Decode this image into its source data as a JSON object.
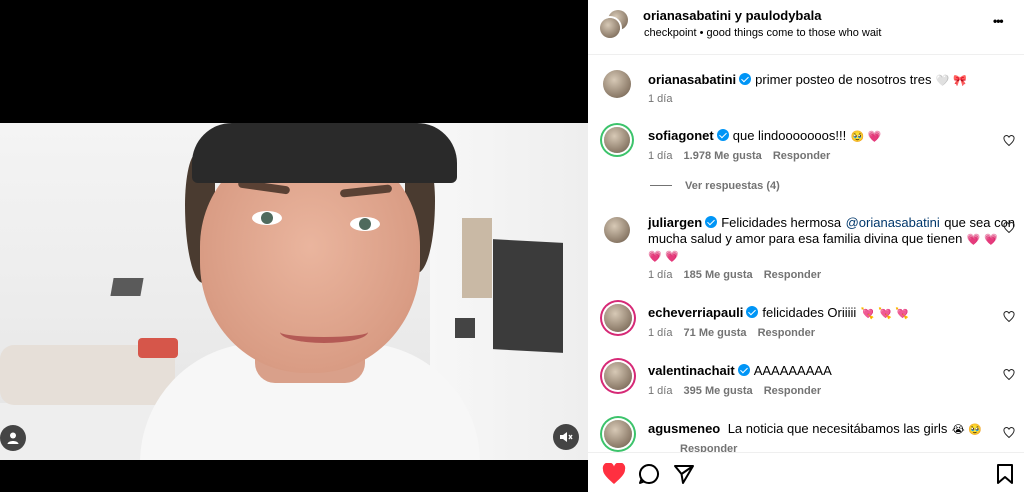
{
  "header": {
    "authors": "orianasabatini y paulodybala",
    "subtitle": "checkpoint • good things come to those who wait",
    "more_label": "•••"
  },
  "caption": {
    "username": "orianasabatini",
    "text": "primer posteo de nosotros tres",
    "emoji": "🤍 🎀",
    "time": "1 día"
  },
  "comments": [
    {
      "username": "sofiagonet",
      "text": "que lindooooooos!!!",
      "emoji": "🥹 💗",
      "time": "1 día",
      "likes": "1.978 Me gusta",
      "reply": "Responder",
      "view_replies": "Ver respuestas (4)"
    },
    {
      "username": "juliargen",
      "text_start": "Felicidades hermosa",
      "mention": "@orianasabatini",
      "text_end": "que sea con",
      "text_line2": "mucha salud y amor para esa familia divina que tienen",
      "emoji_line2": "💗 💗",
      "emoji_line3": "💗 💗",
      "time": "1 día",
      "likes": "185 Me gusta",
      "reply": "Responder"
    },
    {
      "username": "echeverriapauli",
      "text": "felicidades Oriiiii",
      "emoji": "💘 💘 💘",
      "time": "1 día",
      "likes": "71 Me gusta",
      "reply": "Responder"
    },
    {
      "username": "valentinachait",
      "text": "AAAAAAAAA",
      "time": "1 día",
      "likes": "395 Me gusta",
      "reply": "Responder"
    },
    {
      "username": "agusmeneo",
      "text": "La noticia que necesitábamos las girls",
      "emoji": "😭 🥹",
      "reply": "Responder"
    }
  ],
  "colors": {
    "like_red": "#ff3040",
    "verified_blue": "#0095f6",
    "meta_gray": "#737373",
    "mention_blue": "#00376b"
  },
  "icons": [
    "user-icon",
    "mute-icon",
    "more-icon",
    "heart-icon",
    "comment-icon",
    "share-icon",
    "bookmark-icon",
    "verified-icon"
  ]
}
